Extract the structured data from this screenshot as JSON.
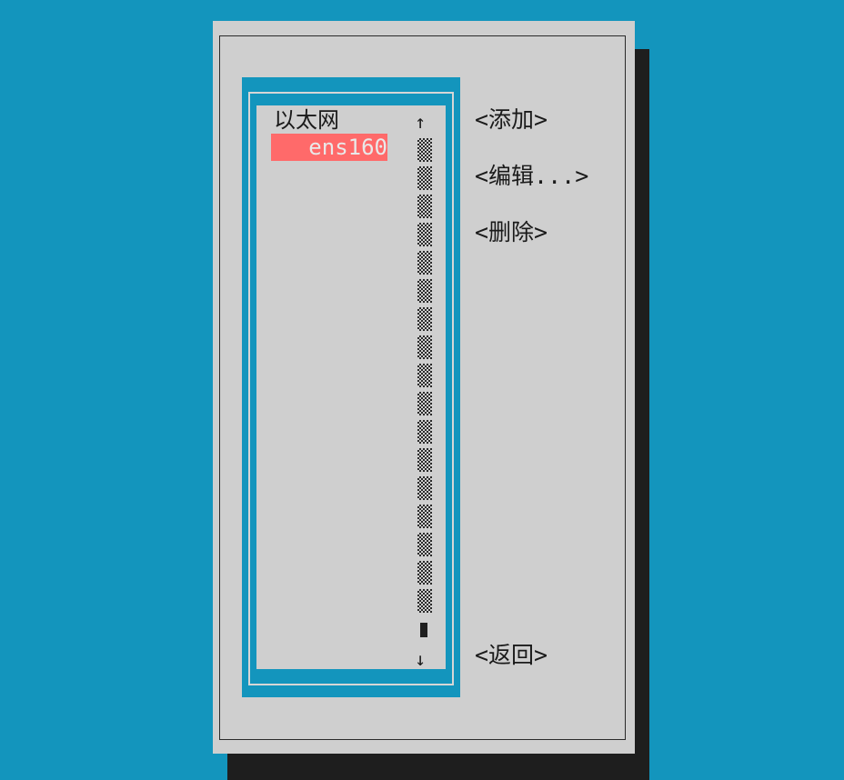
{
  "connection_list": {
    "group_label": "以太网",
    "selected_item": "ens160",
    "scroll_up_glyph": "↑",
    "scroll_down_glyph": "↓"
  },
  "buttons": {
    "add": "<添加>",
    "edit": "<编辑...>",
    "delete": "<删除>",
    "back": "<返回>"
  },
  "colors": {
    "background": "#1395bd",
    "dialog": "#cfcfcf",
    "selection": "#ff6a6a",
    "shadow": "#1e1e1e"
  }
}
